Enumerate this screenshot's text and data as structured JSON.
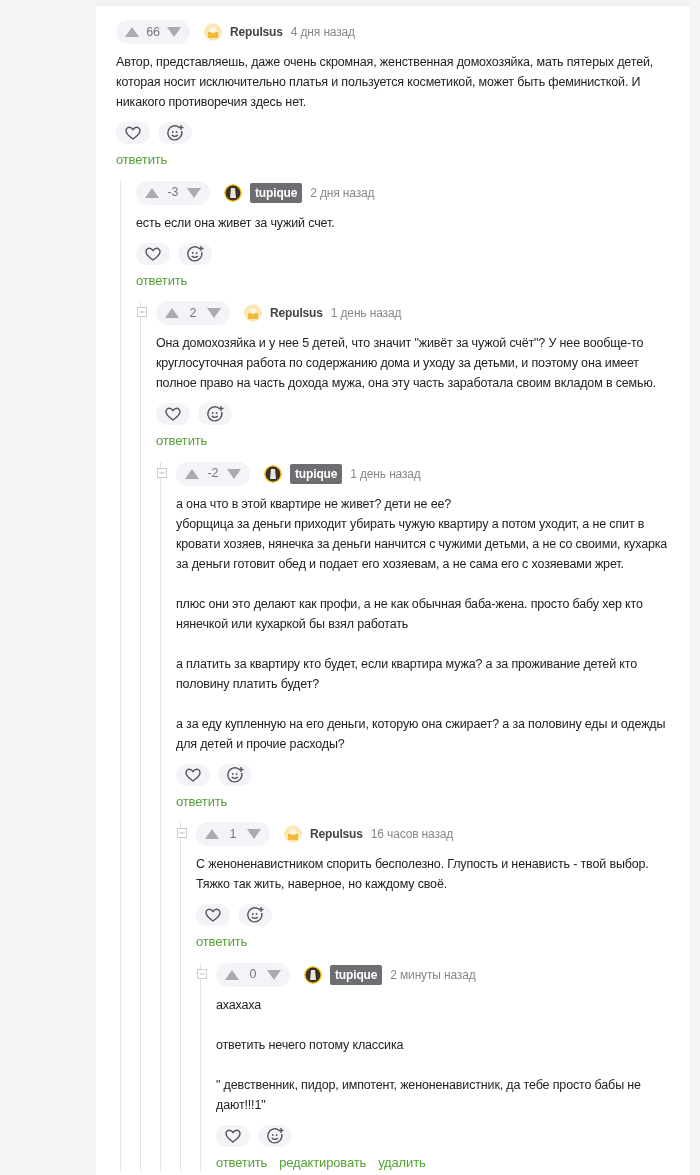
{
  "comments": [
    {
      "rating": "66",
      "author": "Repulsus",
      "author_badge": false,
      "time": "4 дня назад",
      "paragraphs": [
        "Автор, представляешь, даже очень скромная, женственная домохозяйка, мать пятерых детей, которая носит исключительно платья и пользуется косметикой, может быть феминисткой. И никакого противоречия здесь нет."
      ],
      "links": [
        "ответить"
      ],
      "children": [
        {
          "rating": "-3",
          "author": "tupique",
          "author_badge": true,
          "time": "2 дня назад",
          "paragraphs": [
            "есть если она живет за чужий счет."
          ],
          "links": [
            "ответить"
          ],
          "children": [
            {
              "expanded": true,
              "rating": "2",
              "author": "Repulsus",
              "author_badge": false,
              "time": "1 день назад",
              "paragraphs": [
                "Она домохозяйка и у нее 5 детей, что значит \"живёт за чужой счёт\"? У нее вообще-то круглосуточная работа по содержанию дома и уходу за детьми, и поэтому она имеет полное право на часть дохода мужа, она эту часть заработала своим вкладом в семью."
              ],
              "links": [
                "ответить"
              ],
              "children": [
                {
                  "expanded": true,
                  "rating": "-2",
                  "author": "tupique",
                  "author_badge": true,
                  "time": "1 день назад",
                  "paragraphs": [
                    "а она что в этой квартире не живет? дети не ее?\nуборщица за деньги приходит убирать чужую квартиру а потом уходит, а не спит в кровати хозяев, нянечка за деньги нанчится с чужими детьми, а не со своими, кухарка за деньги готовит обед и подает его хозяевам, а не сама его с хозяевами жрет.",
                    "плюс они это делают как профи, а не как обычная баба-жена. просто бабу хер кто нянечкой или кухаркой бы взял работать",
                    "а платить за квартиру кто будет, если квартира мужа? а за проживание детей кто половину платить будет?",
                    "а за еду купленную на его деньги, которую она сжирает? а за половину еды и одежды для детей и прочие расходы?"
                  ],
                  "links": [
                    "ответить"
                  ],
                  "children": [
                    {
                      "expanded": true,
                      "rating": "1",
                      "author": "Repulsus",
                      "author_badge": false,
                      "time": "16 часов назад",
                      "paragraphs": [
                        "С женоненавистником спорить бесполезно. Глупость и ненависть - твой выбор. Тяжко так жить, наверное, но каждому своё."
                      ],
                      "links": [
                        "ответить"
                      ],
                      "children": [
                        {
                          "expanded": true,
                          "rating": "0",
                          "author": "tupique",
                          "author_badge": true,
                          "time": "2 минуты назад",
                          "paragraphs": [
                            "ахахаха",
                            "ответить нечего потому классика",
                            "\" девственник, пидор, импотент, женоненавистник, да тебе просто бабы не дают!!!1\""
                          ],
                          "links": [
                            "ответить",
                            "редактировать",
                            "удалить"
                          ]
                        }
                      ]
                    }
                  ]
                }
              ]
            }
          ]
        }
      ]
    }
  ]
}
